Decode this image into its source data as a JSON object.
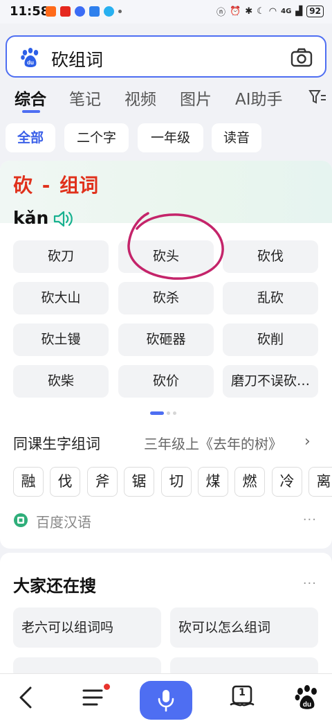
{
  "status": {
    "time": "11:58",
    "network": "4G",
    "battery": "92"
  },
  "search": {
    "query": "砍组词"
  },
  "tabs": [
    "综合",
    "笔记",
    "视频",
    "图片",
    "AI助手"
  ],
  "chips": [
    "全部",
    "二个字",
    "一年级",
    "读音"
  ],
  "result": {
    "char": "砍",
    "separator": "-",
    "title_suffix": "组词",
    "pinyin": "kǎn",
    "words": [
      "砍刀",
      "砍头",
      "砍伐",
      "砍大山",
      "砍杀",
      "乱砍",
      "砍土镘",
      "砍砸器",
      "砍削",
      "砍柴",
      "砍价",
      "磨刀不误砍…"
    ],
    "same_lesson_title": "同课生字组词",
    "same_lesson_sub": "三年级上《去年的树》",
    "chars": [
      "融",
      "伐",
      "斧",
      "锯",
      "切",
      "煤",
      "燃",
      "冷",
      "离"
    ],
    "source": "百度汉语",
    "more": "···"
  },
  "also_search": {
    "title": "大家还在搜",
    "more": "···",
    "items": [
      "老六可以组词吗",
      "砍可以怎么组词"
    ]
  },
  "bottom": {
    "tabs_badge": "1"
  },
  "colors": {
    "accent": "#4e6ef2",
    "title_red": "#e0311c",
    "annotation_circle": "#c4246a"
  },
  "icons": [
    "baidu-paw-icon",
    "camera-icon",
    "filter-icon",
    "speaker-icon",
    "back-icon",
    "menu-icon",
    "mic-icon",
    "tabs-icon",
    "baidu-home-icon"
  ]
}
